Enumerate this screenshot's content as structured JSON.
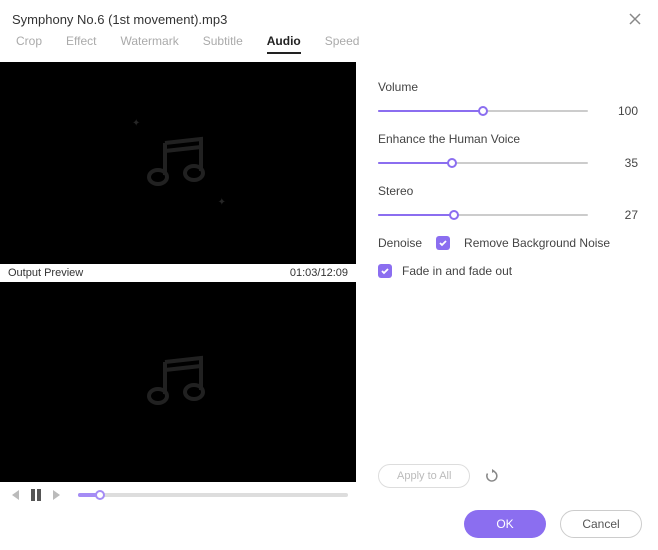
{
  "header": {
    "title": "Symphony No.6 (1st movement).mp3"
  },
  "tabs": {
    "items": [
      "Crop",
      "Effect",
      "Watermark",
      "Subtitle",
      "Audio",
      "Speed"
    ],
    "active": 4
  },
  "preview": {
    "output_label": "Output Preview",
    "time": "01:03/12:09"
  },
  "audio": {
    "volume": {
      "label": "Volume",
      "value": 100,
      "pct": 50
    },
    "enhance": {
      "label": "Enhance the Human Voice",
      "value": 35,
      "pct": 35
    },
    "stereo": {
      "label": "Stereo",
      "value": 27,
      "pct": 36
    },
    "denoise_label": "Denoise",
    "remove_noise": {
      "label": "Remove Background Noise",
      "checked": true
    },
    "fade": {
      "label": "Fade in and fade out",
      "checked": true
    },
    "apply_all": "Apply to All"
  },
  "footer": {
    "ok": "OK",
    "cancel": "Cancel"
  }
}
